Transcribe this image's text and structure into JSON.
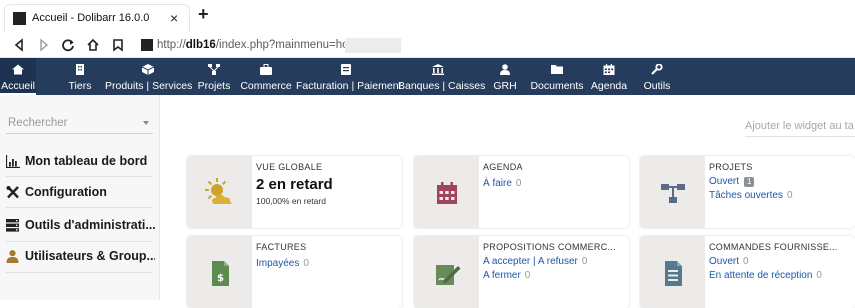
{
  "browser": {
    "tab_title": "Accueil - Dolibarr 16.0.0",
    "tab_close": "×",
    "new_tab": "+",
    "url_prefix": "http://",
    "url_host": "dlb16",
    "url_path": "/index.php?mainmenu=home"
  },
  "topmenu": {
    "items": [
      {
        "label": "Accueil",
        "icon": "home-icon",
        "active": true
      },
      {
        "label": "Tiers",
        "icon": "building-icon"
      },
      {
        "label": "Produits | Services",
        "icon": "cube-icon"
      },
      {
        "label": "Projets",
        "icon": "project-icon"
      },
      {
        "label": "Commerce",
        "icon": "briefcase-icon"
      },
      {
        "label": "Facturation | Paiement",
        "icon": "invoice-icon"
      },
      {
        "label": "Banques | Caisses",
        "icon": "bank-icon"
      },
      {
        "label": "GRH",
        "icon": "user-icon"
      },
      {
        "label": "Documents",
        "icon": "folder-icon"
      },
      {
        "label": "Agenda",
        "icon": "calendar-icon"
      },
      {
        "label": "Outils",
        "icon": "wrench-icon"
      }
    ]
  },
  "sidebar": {
    "search_placeholder": "Rechercher",
    "items": [
      {
        "label": "Mon tableau de bord",
        "icon": "chart-icon"
      },
      {
        "label": "Configuration",
        "icon": "tools-icon"
      },
      {
        "label": "Outils d'administrati...",
        "icon": "server-icon"
      },
      {
        "label": "Utilisateurs & Group...",
        "icon": "user-icon"
      }
    ]
  },
  "widget": {
    "placeholder": "Ajouter le widget au ta"
  },
  "cards": {
    "vue": {
      "title": "VUE GLOBALE",
      "main": "2 en retard",
      "sub": "100,00% en retard",
      "icon": "weather-icon"
    },
    "agenda": {
      "title": "AGENDA",
      "line1_label": "À faire",
      "line1_count": "0",
      "icon": "calendar-icon"
    },
    "projets": {
      "title": "PROJETS",
      "line1_label": "Ouvert",
      "line1_badge": "1",
      "line2_label": "Tâches ouvertes",
      "line2_count": "0",
      "icon": "project-icon"
    },
    "factures": {
      "title": "FACTURES",
      "line1_label": "Impayées",
      "line1_count": "0",
      "icon": "invoice-dollar-icon"
    },
    "propositions": {
      "title": "PROPOSITIONS COMMERC...",
      "line1_label": "A accepter | A refuser",
      "line1_count": "0",
      "line2_label": "A fermer",
      "line2_count": "0",
      "icon": "proposal-icon"
    },
    "commandes": {
      "title": "COMMANDES FOURNISSE...",
      "line1_label": "Ouvert",
      "line1_count": "0",
      "line2_label": "En attente de réception",
      "line2_count": "0",
      "icon": "order-icon"
    }
  },
  "colors": {
    "menu_bg": "#263c5c",
    "link": "#1d58a8",
    "icon_agenda": "#a0445a",
    "icon_projects": "#5a6b8a",
    "icon_invoice": "#5d8a4e",
    "icon_proposal": "#6a8a5a",
    "icon_order": "#557a8e",
    "icon_weather": "#cfa22a"
  }
}
